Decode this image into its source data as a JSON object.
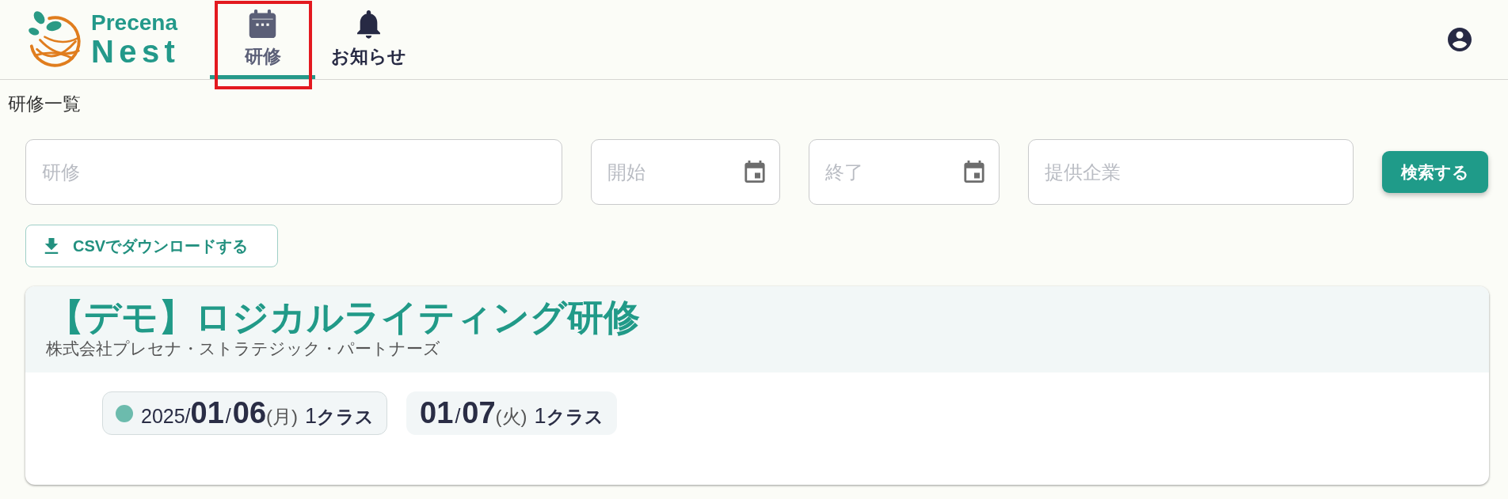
{
  "header": {
    "logo": {
      "line1": "Precena",
      "line2": "Nest"
    },
    "tabs": [
      {
        "kind": "calendar",
        "label": "研修",
        "selected": true,
        "highlighted": true
      },
      {
        "kind": "bell",
        "label": "お知らせ",
        "selected": false,
        "highlighted": false
      }
    ]
  },
  "page_title": "研修一覧",
  "search": {
    "fields": [
      {
        "kind": "text",
        "placeholder": "研修"
      },
      {
        "kind": "date",
        "placeholder": "開始"
      },
      {
        "kind": "date",
        "placeholder": "終了"
      },
      {
        "kind": "text",
        "placeholder": "提供企業"
      }
    ],
    "button": "検索する"
  },
  "download_button": "CSVでダウンロードする",
  "trainings": [
    {
      "title": "【デモ】ロジカルライティング研修",
      "company": "株式会社プレセナ・ストラテジック・パートナーズ",
      "sessions": [
        {
          "year": "2025/",
          "month": "01",
          "separator": "/",
          "day": "06",
          "weekday": "(月)",
          "count": "1",
          "unit": "クラス",
          "selected": true
        },
        {
          "month": "01",
          "separator": "/",
          "day": "07",
          "weekday": "(火)",
          "count": "1",
          "unit": "クラス",
          "selected": false
        }
      ]
    }
  ]
}
